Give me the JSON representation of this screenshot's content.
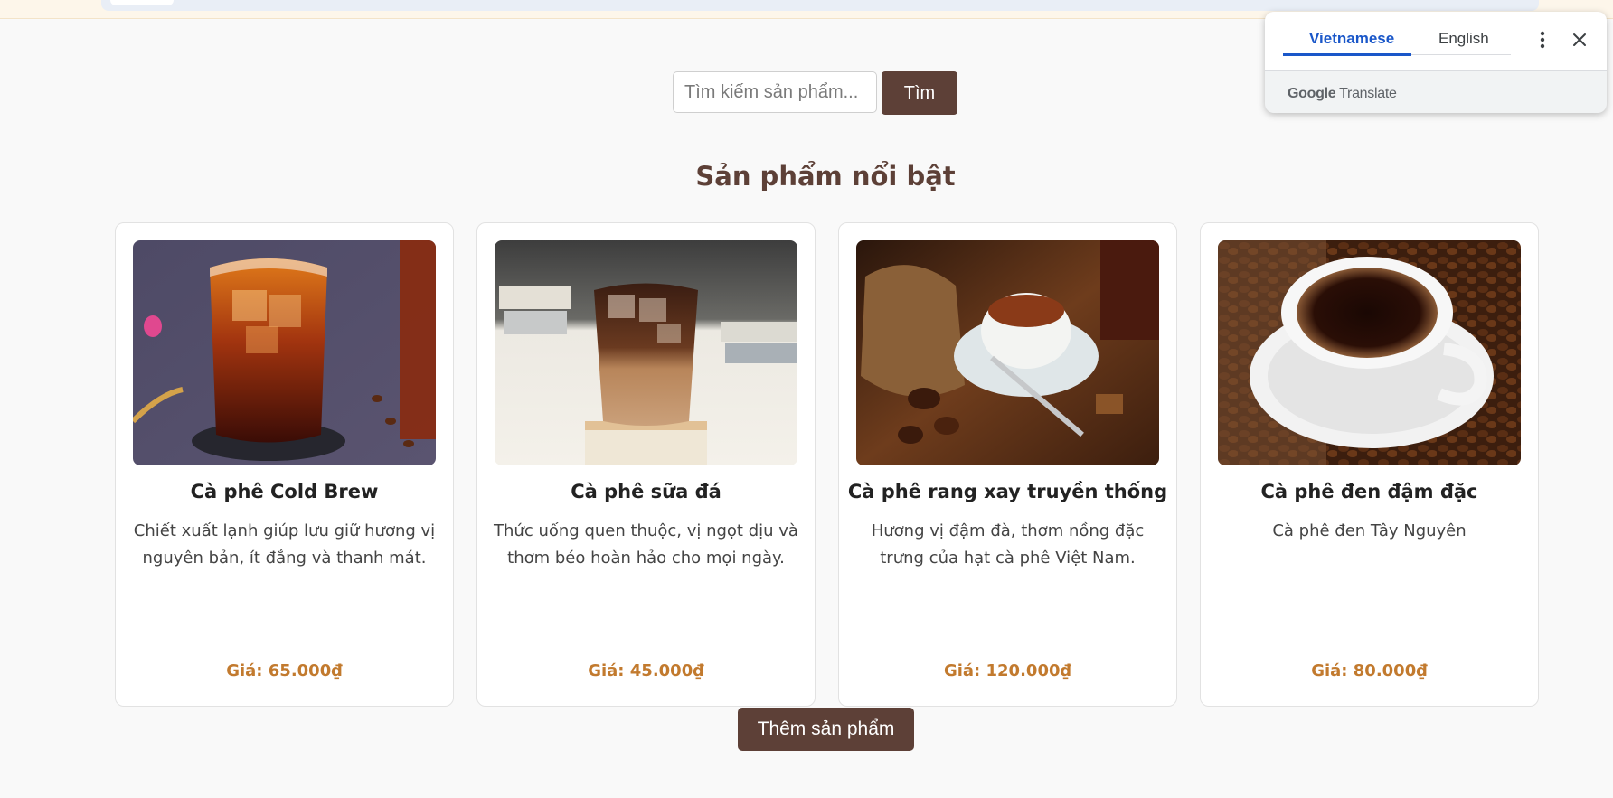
{
  "search": {
    "placeholder": "Tìm kiếm sản phẩm...",
    "button_label": "Tìm"
  },
  "section": {
    "title": "Sản phẩm nổi bật"
  },
  "products": [
    {
      "name": "Cà phê Cold Brew",
      "description": "Chiết xuất lạnh giúp lưu giữ hương vị nguyên bản, ít đắng và thanh mát.",
      "price": "Giá: 65.000₫",
      "image": "iced-cold-brew-glass"
    },
    {
      "name": "Cà phê sữa đá",
      "description": "Thức uống quen thuộc, vị ngọt dịu và thơm béo hoàn hảo cho mọi ngày.",
      "price": "Giá: 45.000₫",
      "image": "iced-milk-coffee-glass"
    },
    {
      "name": "Cà phê rang xay truyền thống",
      "description": "Hương vị đậm đà, thơm nồng đặc trưng của hạt cà phê Việt Nam.",
      "price": "Giá: 120.000₫",
      "image": "coffee-cup-with-beans-sack"
    },
    {
      "name": "Cà phê đen đậm đặc",
      "description": "Cà phê đen Tây Nguyên",
      "price": "Giá: 80.000₫",
      "image": "black-coffee-cup-on-beans"
    }
  ],
  "actions": {
    "add_product_label": "Thêm sản phẩm"
  },
  "translate_popup": {
    "tab_source": "Vietnamese",
    "tab_target": "English",
    "brand_google": "Google",
    "brand_product": "Translate",
    "active_color": "#1a57c9"
  },
  "colors": {
    "brand_brown": "#5d4037",
    "price_color": "#c27a2e",
    "page_background": "#f9f9f9"
  }
}
